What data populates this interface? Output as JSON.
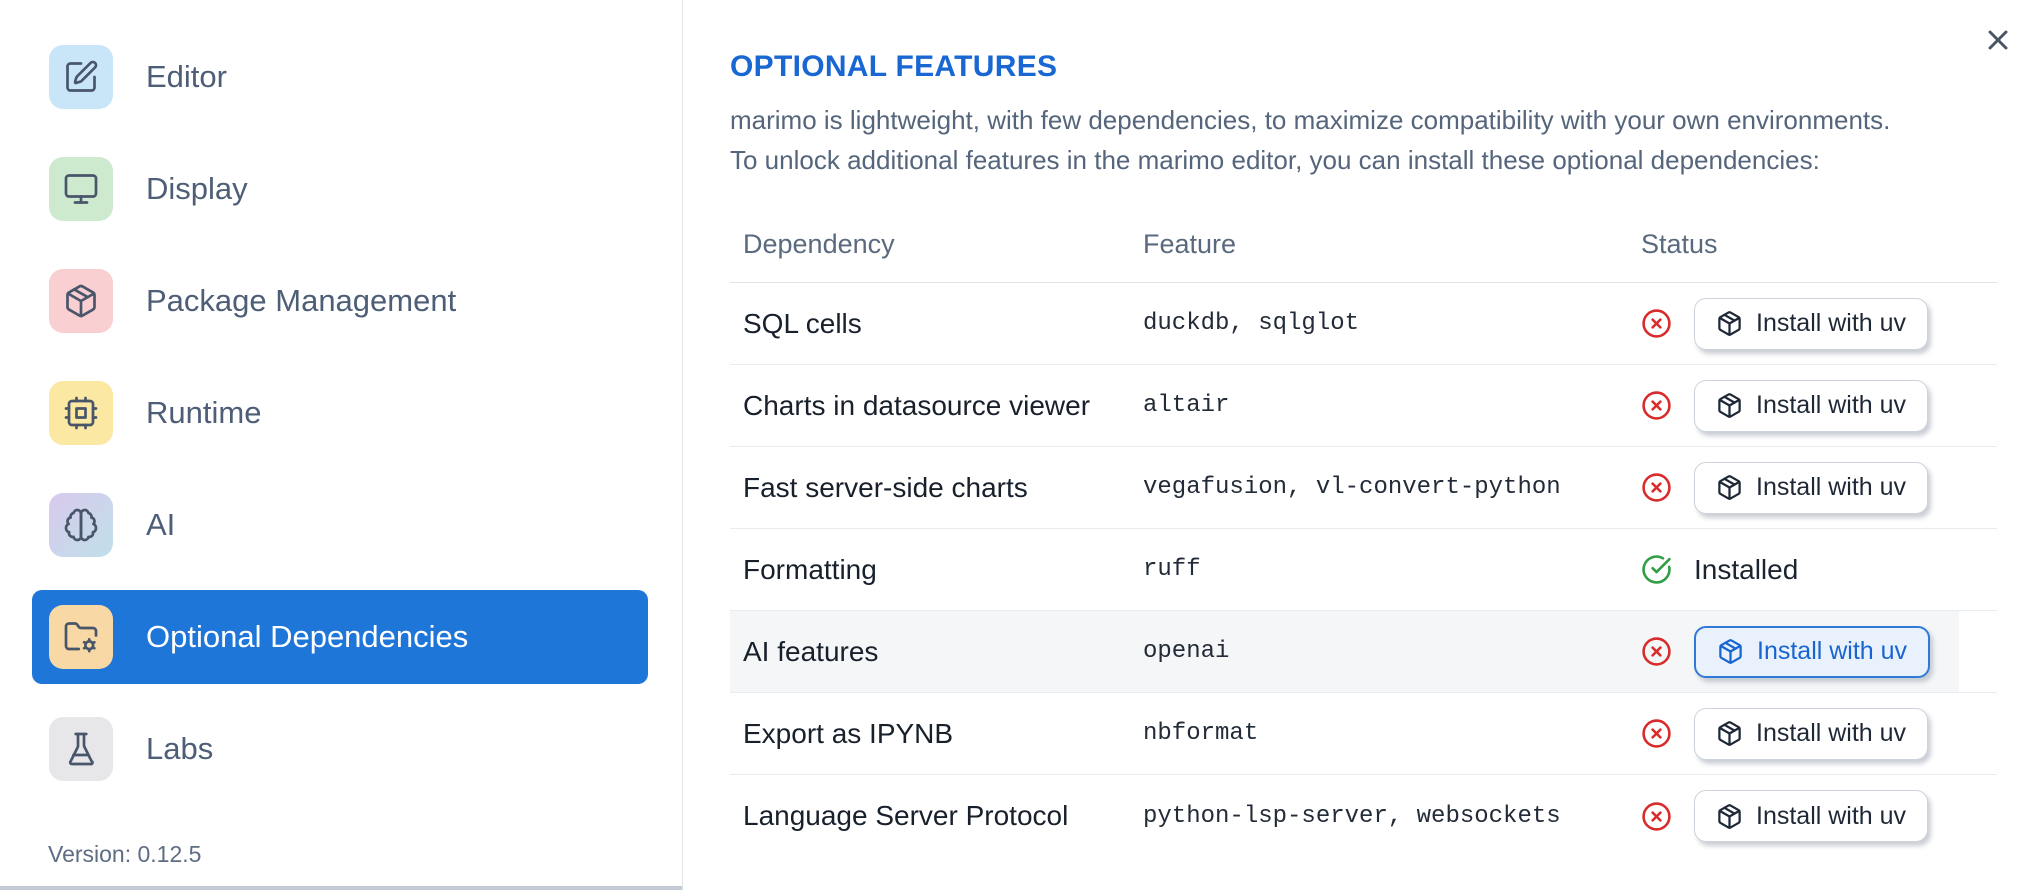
{
  "sidebar": {
    "items": [
      {
        "label": "Editor",
        "icon": "square-pen-icon",
        "tile_color": "#c9e6f9",
        "selected": false
      },
      {
        "label": "Display",
        "icon": "monitor-icon",
        "tile_color": "#cdeacf",
        "selected": false
      },
      {
        "label": "Package Management",
        "icon": "package-icon",
        "tile_color": "#f9cfd2",
        "selected": false
      },
      {
        "label": "Runtime",
        "icon": "cpu-icon",
        "tile_color": "#fbe8a2",
        "selected": false
      },
      {
        "label": "AI",
        "icon": "brain-icon",
        "tile_color": "#d9c9ec",
        "tile_color_2": "#bfe0ea",
        "selected": false
      },
      {
        "label": "Optional Dependencies",
        "icon": "folder-cog-icon",
        "tile_color": "#f8d8a4",
        "selected": true
      },
      {
        "label": "Labs",
        "icon": "flask-icon",
        "tile_color": "#e7e7ea",
        "selected": false
      }
    ],
    "version_label": "Version: 0.12.5"
  },
  "main": {
    "title": "OPTIONAL FEATURES",
    "description_lines": [
      "marimo is lightweight, with few dependencies, to maximize compatibility with your own environments.",
      "To unlock additional features in the marimo editor, you can install these optional dependencies:"
    ],
    "table": {
      "headers": [
        "Dependency",
        "Feature",
        "Status"
      ],
      "rows": [
        {
          "dependency": "SQL cells",
          "feature": "duckdb, sqlglot",
          "installed": false,
          "action_label": "Install with uv",
          "highlighted": false
        },
        {
          "dependency": "Charts in datasource viewer",
          "feature": "altair",
          "installed": false,
          "action_label": "Install with uv",
          "highlighted": false
        },
        {
          "dependency": "Fast server-side charts",
          "feature": "vegafusion, vl-convert-python",
          "installed": false,
          "action_label": "Install with uv",
          "highlighted": false
        },
        {
          "dependency": "Formatting",
          "feature": "ruff",
          "installed": true,
          "status_label": "Installed",
          "highlighted": false
        },
        {
          "dependency": "AI features",
          "feature": "openai",
          "installed": false,
          "action_label": "Install with uv",
          "highlighted": true
        },
        {
          "dependency": "Export as IPYNB",
          "feature": "nbformat",
          "installed": false,
          "action_label": "Install with uv",
          "highlighted": false
        },
        {
          "dependency": "Language Server Protocol",
          "feature": "python-lsp-server, websockets",
          "installed": false,
          "action_label": "Install with uv",
          "highlighted": false
        }
      ]
    }
  },
  "colors": {
    "accent_blue": "#1e76d9",
    "title_blue": "#1967d2",
    "danger_red": "#d92b2b",
    "success_green": "#2f9e44",
    "highlight_button_bg": "#e9f1fc",
    "highlight_button_border": "#3079d6"
  }
}
